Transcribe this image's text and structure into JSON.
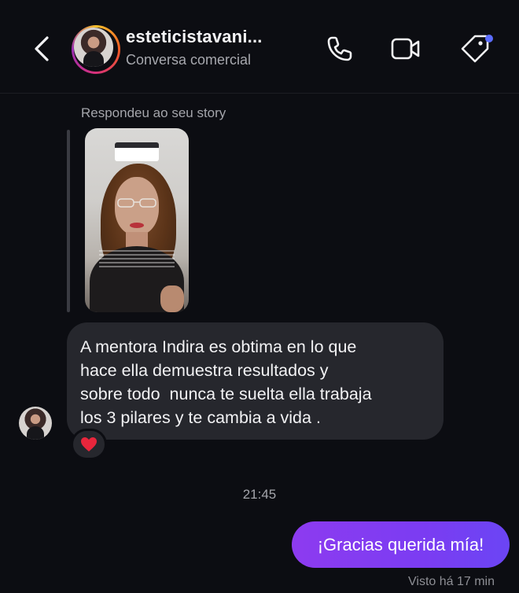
{
  "header": {
    "username": "esteticistavani...",
    "subtitle": "Conversa comercial",
    "notification_dot_color": "#5b6cff",
    "icons": [
      "back-chevron-icon",
      "phone-icon",
      "video-call-icon",
      "tag-icon"
    ]
  },
  "story_reply": {
    "label": "Respondeu ao seu story"
  },
  "messages": {
    "incoming": {
      "text": "A mentora Indira es obtima en lo que\nhace ella demuestra resultados y\nsobre todo  nunca te suelta ella trabaja\nlos 3 pilares y te cambia a vida .",
      "reaction": "❤️"
    },
    "timestamp": "21:45",
    "outgoing": {
      "text": "¡Gracias querida mía!",
      "status": "Visto há 17 min"
    }
  },
  "colors": {
    "background": "#0c0d12",
    "incoming_bubble": "#26272d",
    "outgoing_bubble_start": "#8d3bf0",
    "outgoing_bubble_end": "#6b45f4"
  }
}
